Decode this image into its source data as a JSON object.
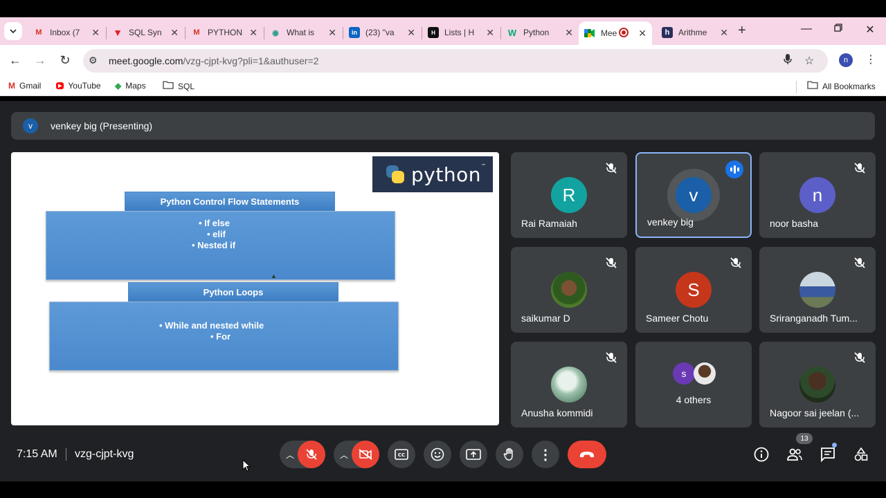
{
  "browser": {
    "tabs": [
      {
        "label": "Inbox (7",
        "icon": "gmail-icon"
      },
      {
        "label": "SQL Syn",
        "icon": "v-logo-icon"
      },
      {
        "label": "PYTHON",
        "icon": "gmail-icon"
      },
      {
        "label": "What is",
        "icon": "eye-icon"
      },
      {
        "label": "(23) \"va",
        "icon": "linkedin-icon"
      },
      {
        "label": "Lists | H",
        "icon": "hackernoon-icon"
      },
      {
        "label": "Python",
        "icon": "w3schools-icon"
      },
      {
        "label": "Mee",
        "icon": "meet-icon"
      },
      {
        "label": "Arithme",
        "icon": "h-logo-icon"
      }
    ],
    "url_host": "meet.google.com",
    "url_rest": "/vzg-cjpt-kvg?pli=1&authuser=2",
    "profile_initial": "n",
    "bookmarks": [
      {
        "label": "Gmail"
      },
      {
        "label": "YouTube"
      },
      {
        "label": "Maps"
      },
      {
        "label": "SQL"
      }
    ],
    "all_bookmarks": "All Bookmarks"
  },
  "meet": {
    "presenter_initial": "v",
    "presenting_label": "venkey big (Presenting)",
    "slide": {
      "logo_text": "python",
      "logo_tm": "™",
      "section1_title": "Python Control Flow Statements",
      "section1_items": [
        "•  If else",
        "•  elif",
        "•  Nested if"
      ],
      "section2_title": "Python Loops",
      "section2_items": [
        "•  While and nested while",
        "•  For"
      ]
    },
    "participants": [
      {
        "name": "Rai Ramaiah",
        "initial": "R",
        "color": "#12a3a0",
        "muted": true
      },
      {
        "name": "venkey big",
        "initial": "v",
        "color": "#1a5fa8",
        "muted": false,
        "speaking": true
      },
      {
        "name": "noor basha",
        "initial": "n",
        "color": "#5b5fc7",
        "muted": true
      },
      {
        "name": "saikumar D",
        "initial": "",
        "muted": true,
        "photo": true
      },
      {
        "name": "Sameer Chotu",
        "initial": "S",
        "color": "#c5361b",
        "muted": true
      },
      {
        "name": "Sriranganadh Tum...",
        "initial": "",
        "muted": true,
        "photo": true
      },
      {
        "name": "Anusha kommidi",
        "initial": "",
        "muted": true,
        "photo": true
      },
      {
        "name": "4 others",
        "initial": "s",
        "color": "#6a3ab5",
        "others": true
      },
      {
        "name": "Nagoor sai jeelan (...",
        "initial": "",
        "muted": true,
        "photo": true
      }
    ],
    "time": "7:15 AM",
    "meeting_code": "vzg-cjpt-kvg",
    "people_count": "13",
    "colors": {
      "accent_red": "#ea4335",
      "accent_blue": "#8ab4f8",
      "bg": "#202124",
      "tile": "#3c4043"
    }
  }
}
